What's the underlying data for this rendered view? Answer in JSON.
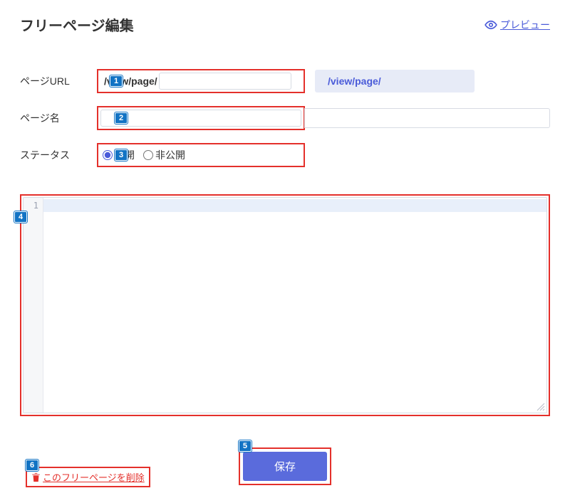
{
  "header": {
    "title": "フリーページ編集",
    "preview_label": "プレビュー"
  },
  "form": {
    "url_label": "ページURL",
    "url_prefix": "/view/page/",
    "url_value": "",
    "url_preview": "/view/page/",
    "name_label": "ページ名",
    "name_value": "",
    "status_label": "ステータス",
    "status_options": {
      "public": "公開",
      "private": "非公開"
    }
  },
  "editor": {
    "line_number": "1",
    "content": ""
  },
  "actions": {
    "save_label": "保存",
    "delete_label": "このフリーページを削除"
  },
  "markers": [
    "1",
    "2",
    "3",
    "4",
    "5",
    "6"
  ],
  "colors": {
    "accent": "#4a5bd9",
    "danger": "#e4302b",
    "marker": "#1273c4"
  }
}
